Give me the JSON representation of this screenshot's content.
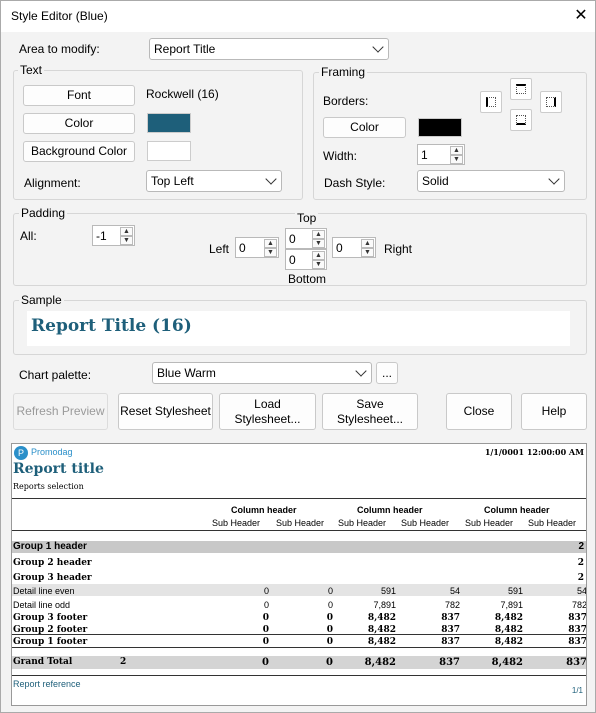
{
  "window": {
    "title": "Style Editor (Blue)"
  },
  "area": {
    "label": "Area to modify:",
    "value": "Report Title"
  },
  "text_group": {
    "legend": "Text",
    "font_button": "Font",
    "font_value": "Rockwell (16)",
    "color_button": "Color",
    "color": "#1e5f7a",
    "bg_button": "Background Color",
    "bg_color": "#ffffff",
    "alignment_label": "Alignment:",
    "alignment_value": "Top Left"
  },
  "framing": {
    "legend": "Framing",
    "borders_label": "Borders:",
    "color_button": "Color",
    "color": "#000000",
    "width_label": "Width:",
    "width_value": "1",
    "dash_label": "Dash Style:",
    "dash_value": "Solid"
  },
  "padding": {
    "legend": "Padding",
    "all_label": "All:",
    "all_value": "-1",
    "top_label": "Top",
    "left_label": "Left",
    "right_label": "Right",
    "bottom_label": "Bottom",
    "top_value": "0",
    "left_value": "0",
    "right_value": "0",
    "bottom_value": "0"
  },
  "sample": {
    "legend": "Sample",
    "text": "Report Title (16)"
  },
  "palette": {
    "label": "Chart palette:",
    "value": "Blue Warm",
    "more": "..."
  },
  "buttons": {
    "refresh": "Refresh Preview",
    "reset": "Reset Stylesheet",
    "load": "Load\nStylesheet...",
    "save": "Save\nStylesheet...",
    "close": "Close",
    "help": "Help"
  },
  "report": {
    "logo": "Promodag",
    "title": "Report title",
    "subtitle": "Reports selection",
    "date": "1/1/0001 12:00:00 AM",
    "col_header": "Column header",
    "sub_header": "Sub Header",
    "group1": "Group 1 header",
    "group2": "Group 2 header",
    "group3": "Group 3 header",
    "g1val": "2",
    "g2val": "2",
    "g3val": "2",
    "rows": [
      {
        "label": "Detail line even",
        "vals": [
          "0",
          "0",
          "591",
          "54",
          "591",
          "54"
        ]
      },
      {
        "label": "Detail line odd",
        "vals": [
          "0",
          "0",
          "7,891",
          "782",
          "7,891",
          "782"
        ]
      },
      {
        "label": "Group 3 footer",
        "vals": [
          "0",
          "0",
          "8,482",
          "837",
          "8,482",
          "837"
        ]
      },
      {
        "label": "Group 2 footer",
        "vals": [
          "0",
          "0",
          "8,482",
          "837",
          "8,482",
          "837"
        ]
      },
      {
        "label": "Group 1 footer",
        "vals": [
          "0",
          "0",
          "8,482",
          "837",
          "8,482",
          "837"
        ]
      }
    ],
    "grand": {
      "label": "Grand Total",
      "count": "2",
      "vals": [
        "0",
        "0",
        "8,482",
        "837",
        "8,482",
        "837"
      ]
    },
    "reference": "Report reference",
    "page": "1/1"
  }
}
